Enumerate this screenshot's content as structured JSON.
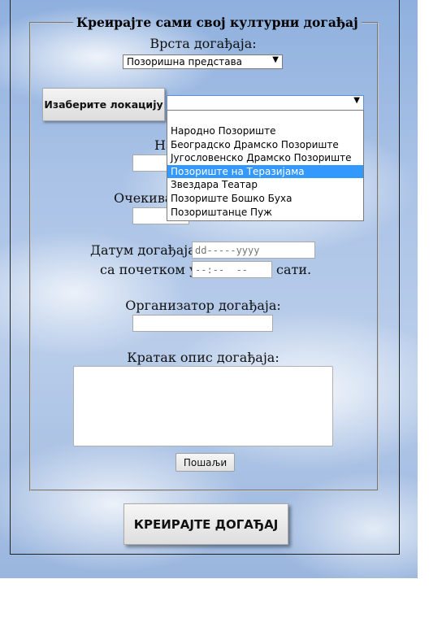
{
  "form": {
    "legend": "Креирајте сами свој културни догађај",
    "event_type_label": "Врста догађаја:",
    "event_type_value": "Позоришна представа",
    "choose_location_button": "Изаберите локацију",
    "location_value": "",
    "location_options": [
      "Народно Позориште",
      "Београдско Драмско Позориште",
      "Југословенско Драмско Позориште",
      "Позориште на Теразијама",
      "Звездара Театар",
      "Позориште Бошко Буха",
      "Позориштанце Пуж"
    ],
    "highlighted_option": "Позориште на Теразијама",
    "name_label_partial": "На",
    "expected_label_partial": "Очекива",
    "date_label": "Датум догађаја:",
    "date_placeholder": "dd-----yyyy",
    "start_label": "са почетком у:",
    "time_placeholder": "--:--  --",
    "hours_suffix": "сати.",
    "organizer_label": "Организатор догађаја:",
    "description_label": "Кратак опис догађаја:",
    "send_button": "Пошаљи"
  },
  "create_button": "КРЕИРАЈТЕ ДОГАЂАЈ",
  "colors": {
    "highlight": "#3399ff",
    "sky": "#a9c2e6"
  },
  "icons": {
    "dropdown_arrow": "chevron-down-icon"
  }
}
